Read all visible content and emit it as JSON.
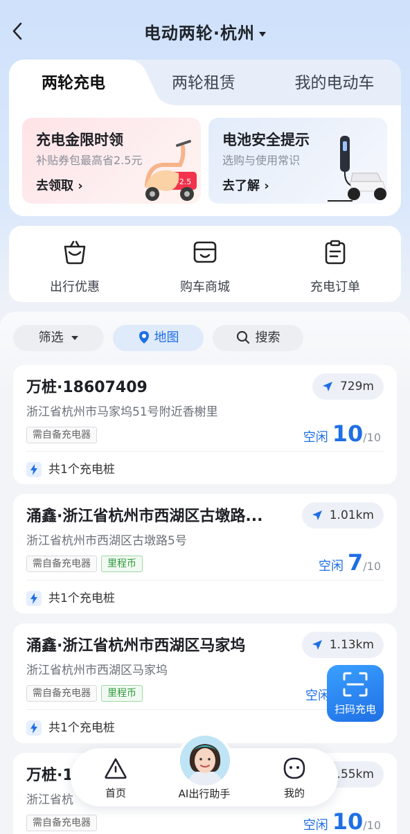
{
  "header": {
    "title": "电动两轮·杭州"
  },
  "tabs": [
    {
      "label": "两轮充电",
      "active": true
    },
    {
      "label": "两轮租赁",
      "active": false
    },
    {
      "label": "我的电动车",
      "active": false
    }
  ],
  "banners": [
    {
      "title": "充电金限时领",
      "subtitle": "补贴券包最高省2.5元",
      "link": "去领取",
      "badge": "¥2.5"
    },
    {
      "title": "电池安全提示",
      "subtitle": "选购与使用常识",
      "link": "去了解"
    }
  ],
  "quick": [
    {
      "label": "出行优惠",
      "icon": "gift-bag-icon"
    },
    {
      "label": "购车商城",
      "icon": "store-icon"
    },
    {
      "label": "充电订单",
      "icon": "order-clipboard-icon"
    }
  ],
  "filters": {
    "filter": "筛选",
    "map": "地图",
    "search": "搜索"
  },
  "stations": [
    {
      "name": "万桩·18607409",
      "address": "浙江省杭州市马家坞51号附近香榭里",
      "distance": "729m",
      "tags": [
        "需自备充电器"
      ],
      "green_tags": [],
      "free_label": "空闲",
      "free": "10",
      "total": "/10",
      "piles": "共1个充电桩"
    },
    {
      "name": "涌鑫·浙江省杭州市西湖区古墩路...",
      "address": "浙江省杭州市西湖区古墩路5号",
      "distance": "1.01km",
      "tags": [
        "需自备充电器"
      ],
      "green_tags": [
        "里程币"
      ],
      "free_label": "空闲",
      "free": "7",
      "total": "/10",
      "piles": "共1个充电桩"
    },
    {
      "name": "涌鑫·浙江省杭州市西湖区马家坞",
      "address": "浙江省杭州市西湖区马家坞",
      "distance": "1.13km",
      "tags": [
        "需自备充电器"
      ],
      "green_tags": [
        "里程币"
      ],
      "free_label": "空闲",
      "free": "",
      "total": "",
      "piles": "共1个充电桩"
    },
    {
      "name": "万桩·1",
      "address": "浙江省杭",
      "distance": ".55km",
      "tags": [
        "需自备充电器"
      ],
      "green_tags": [],
      "free_label": "空闲",
      "free": "10",
      "total": "/10",
      "piles": ""
    }
  ],
  "scan": {
    "label": "扫码充电"
  },
  "nav": {
    "home": "首页",
    "assistant": "AI出行助手",
    "mine": "我的"
  },
  "colors": {
    "accent": "#1f6fe5",
    "green": "#2e9a3a"
  }
}
